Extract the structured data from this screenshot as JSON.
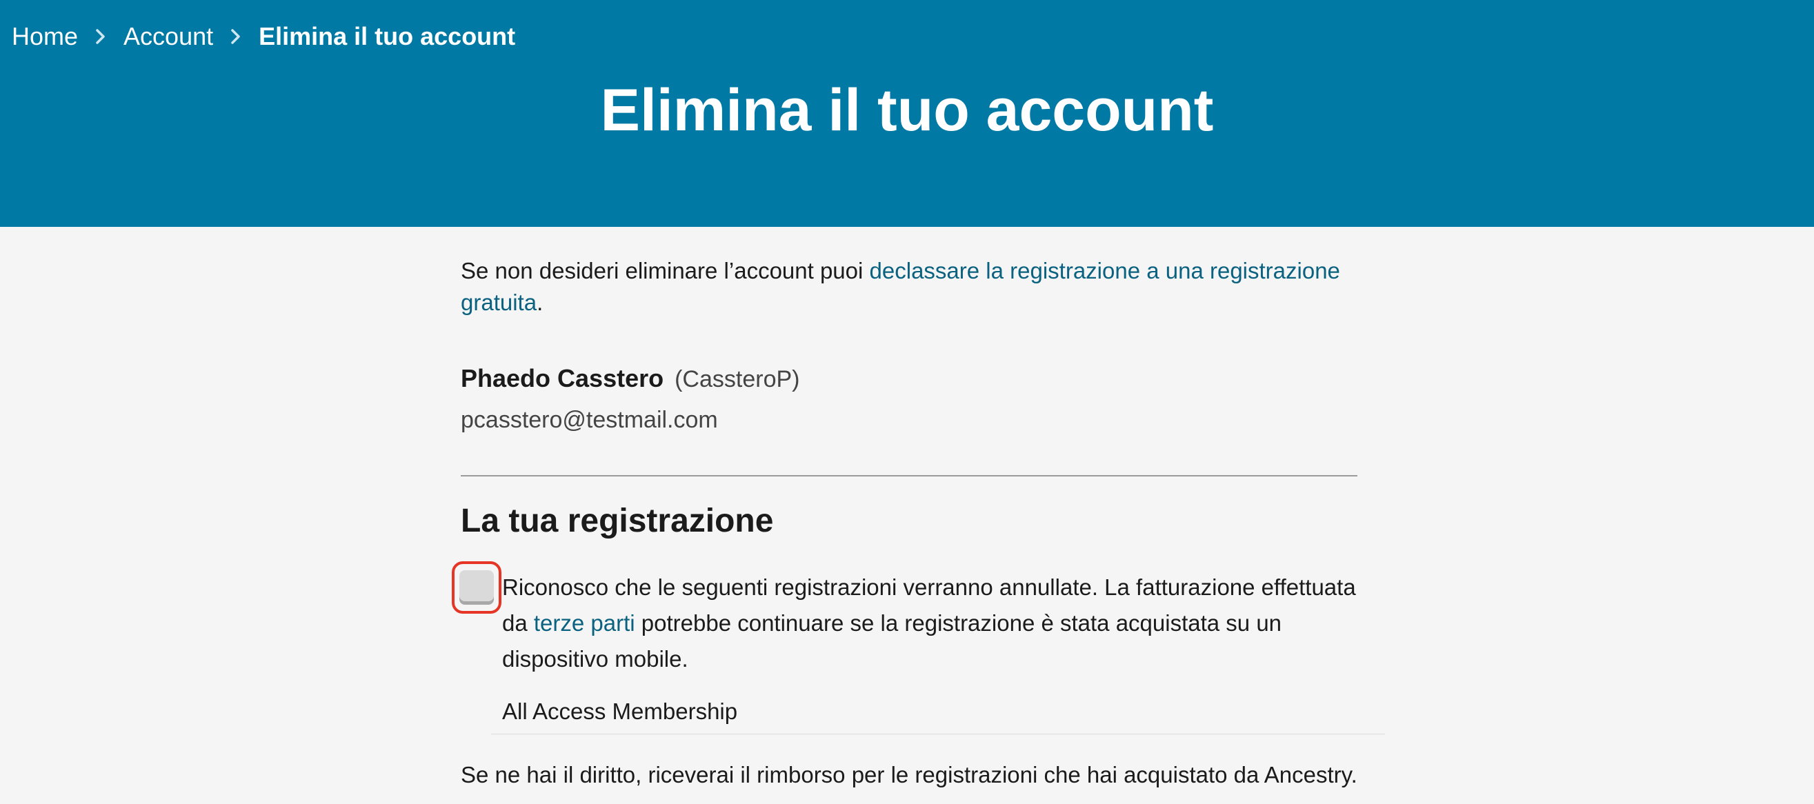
{
  "breadcrumb": {
    "home": "Home",
    "account": "Account",
    "current": "Elimina il tuo account"
  },
  "header": {
    "title": "Elimina il tuo account",
    "bg_color": "#0079a5"
  },
  "intro": {
    "text_before": "Se non desideri eliminare l’account puoi ",
    "link": "declassare la registrazione a una registrazione gratuita",
    "text_after": "."
  },
  "user": {
    "name": "Phaedo Casstero",
    "handle": "(CassteroP)",
    "email": "pcasstero@testmail.com"
  },
  "registration": {
    "title": "La tua registrazione",
    "ack_before": "Riconosco che le seguenti registrazioni verranno annullate. La fatturazione effettuata da ",
    "ack_link": "terze parti",
    "ack_after": " potrebbe continuare se la registrazione è stata acquistata su un dispositivo mobile.",
    "checked": false,
    "membership": "All Access Membership"
  },
  "refund_text": "Se ne hai il diritto, riceverai il rimborso per le registrazioni che hai acquistato da Ancestry.",
  "colors": {
    "link": "#0b6180",
    "highlight": "#e53524"
  }
}
